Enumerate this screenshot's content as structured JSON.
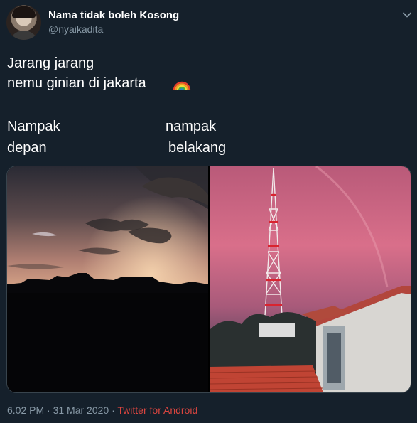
{
  "user": {
    "name": "Nama tidak boleh Kosong",
    "handle": "@nyaikadita"
  },
  "tweet": {
    "line1": "Jarang jarang",
    "line2": "nemu ginian di jakarta",
    "emoji": "rainbow-emoji",
    "left_caption_1": "Nampak",
    "left_caption_2": "depan",
    "right_caption_1": "nampak",
    "right_caption_2": "belakang"
  },
  "media": {
    "images": [
      {
        "description_icon": "sunset-photo"
      },
      {
        "description_icon": "pink-sky-tower-photo"
      }
    ]
  },
  "footer": {
    "time": "6.02 PM",
    "separator": " · ",
    "date": "31 Mar 2020",
    "source": "Twitter for Android"
  },
  "colors": {
    "background": "#15202b",
    "secondary_text": "#8899a6",
    "source_link": "#d9453f"
  }
}
